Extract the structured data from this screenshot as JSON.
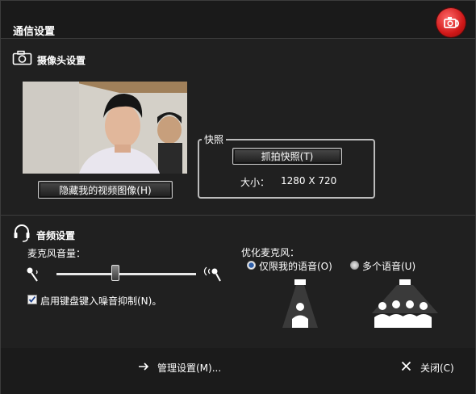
{
  "window": {
    "title": "通信设置"
  },
  "camera": {
    "section_title": "摄像头设置",
    "hide_video_button": "隐藏我的视频图像(H)",
    "snapshot_group_label": "快照",
    "capture_button": "抓拍快照(T)",
    "size_label": "大小：",
    "size_value": "1280 X 720"
  },
  "audio": {
    "section_title": "音频设置",
    "mic_volume_label": "麦克风音量：",
    "mic_volume_level": 0.42,
    "noise_suppression_label": "启用键盘键入噪音抑制(N)。",
    "noise_suppression_checked": true,
    "optimize_label": "优化麦克风：",
    "option_only_my_voice": "仅限我的语音(O)",
    "option_multiple_voices": "多个语音(U)",
    "selected_option": "only_my_voice"
  },
  "footer": {
    "advanced_settings_label": "管理设置(M)...",
    "close_label": "关闭(C)"
  },
  "colors": {
    "background": "#202020",
    "accent_red": "#d01818",
    "radio_blue": "#2f5fa8"
  }
}
